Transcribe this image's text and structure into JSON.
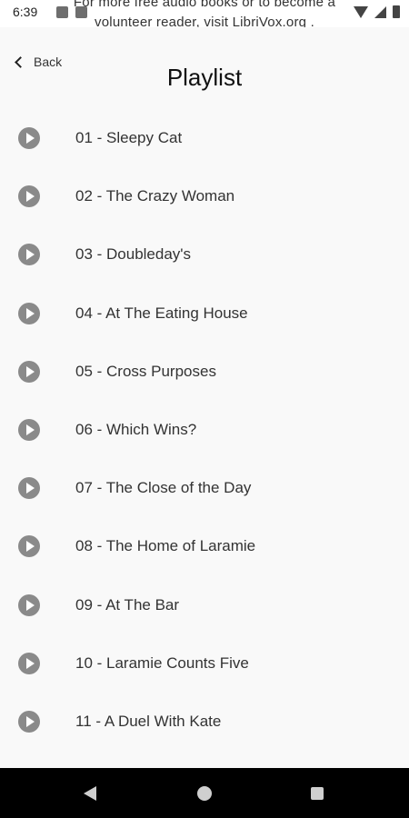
{
  "status_bar": {
    "time": "6:39",
    "notification_line1": "For more free audio books or to become a",
    "notification_line2": "volunteer reader, visit LibriVox.org ."
  },
  "header": {
    "back_label": "Back",
    "title": "Playlist"
  },
  "tracks": [
    {
      "title": "01 - Sleepy Cat"
    },
    {
      "title": "02 - The Crazy Woman"
    },
    {
      "title": "03 - Doubleday's"
    },
    {
      "title": "04 - At The Eating House"
    },
    {
      "title": "05 - Cross Purposes"
    },
    {
      "title": "06 - Which Wins?"
    },
    {
      "title": "07 - The Close of the Day"
    },
    {
      "title": "08 - The Home of Laramie"
    },
    {
      "title": "09 - At The Bar"
    },
    {
      "title": "10 - Laramie Counts Five"
    },
    {
      "title": "11 - A Duel With Kate"
    }
  ],
  "icons": {
    "track": "play-circle-icon",
    "back": "chevron-left-icon",
    "nav_back": "triangle-back-icon",
    "nav_home": "circle-home-icon",
    "nav_recents": "square-recents-icon"
  },
  "colors": {
    "play_icon": "#8a8a8a",
    "background": "#f9f9f9",
    "nav_bar": "#000000"
  }
}
